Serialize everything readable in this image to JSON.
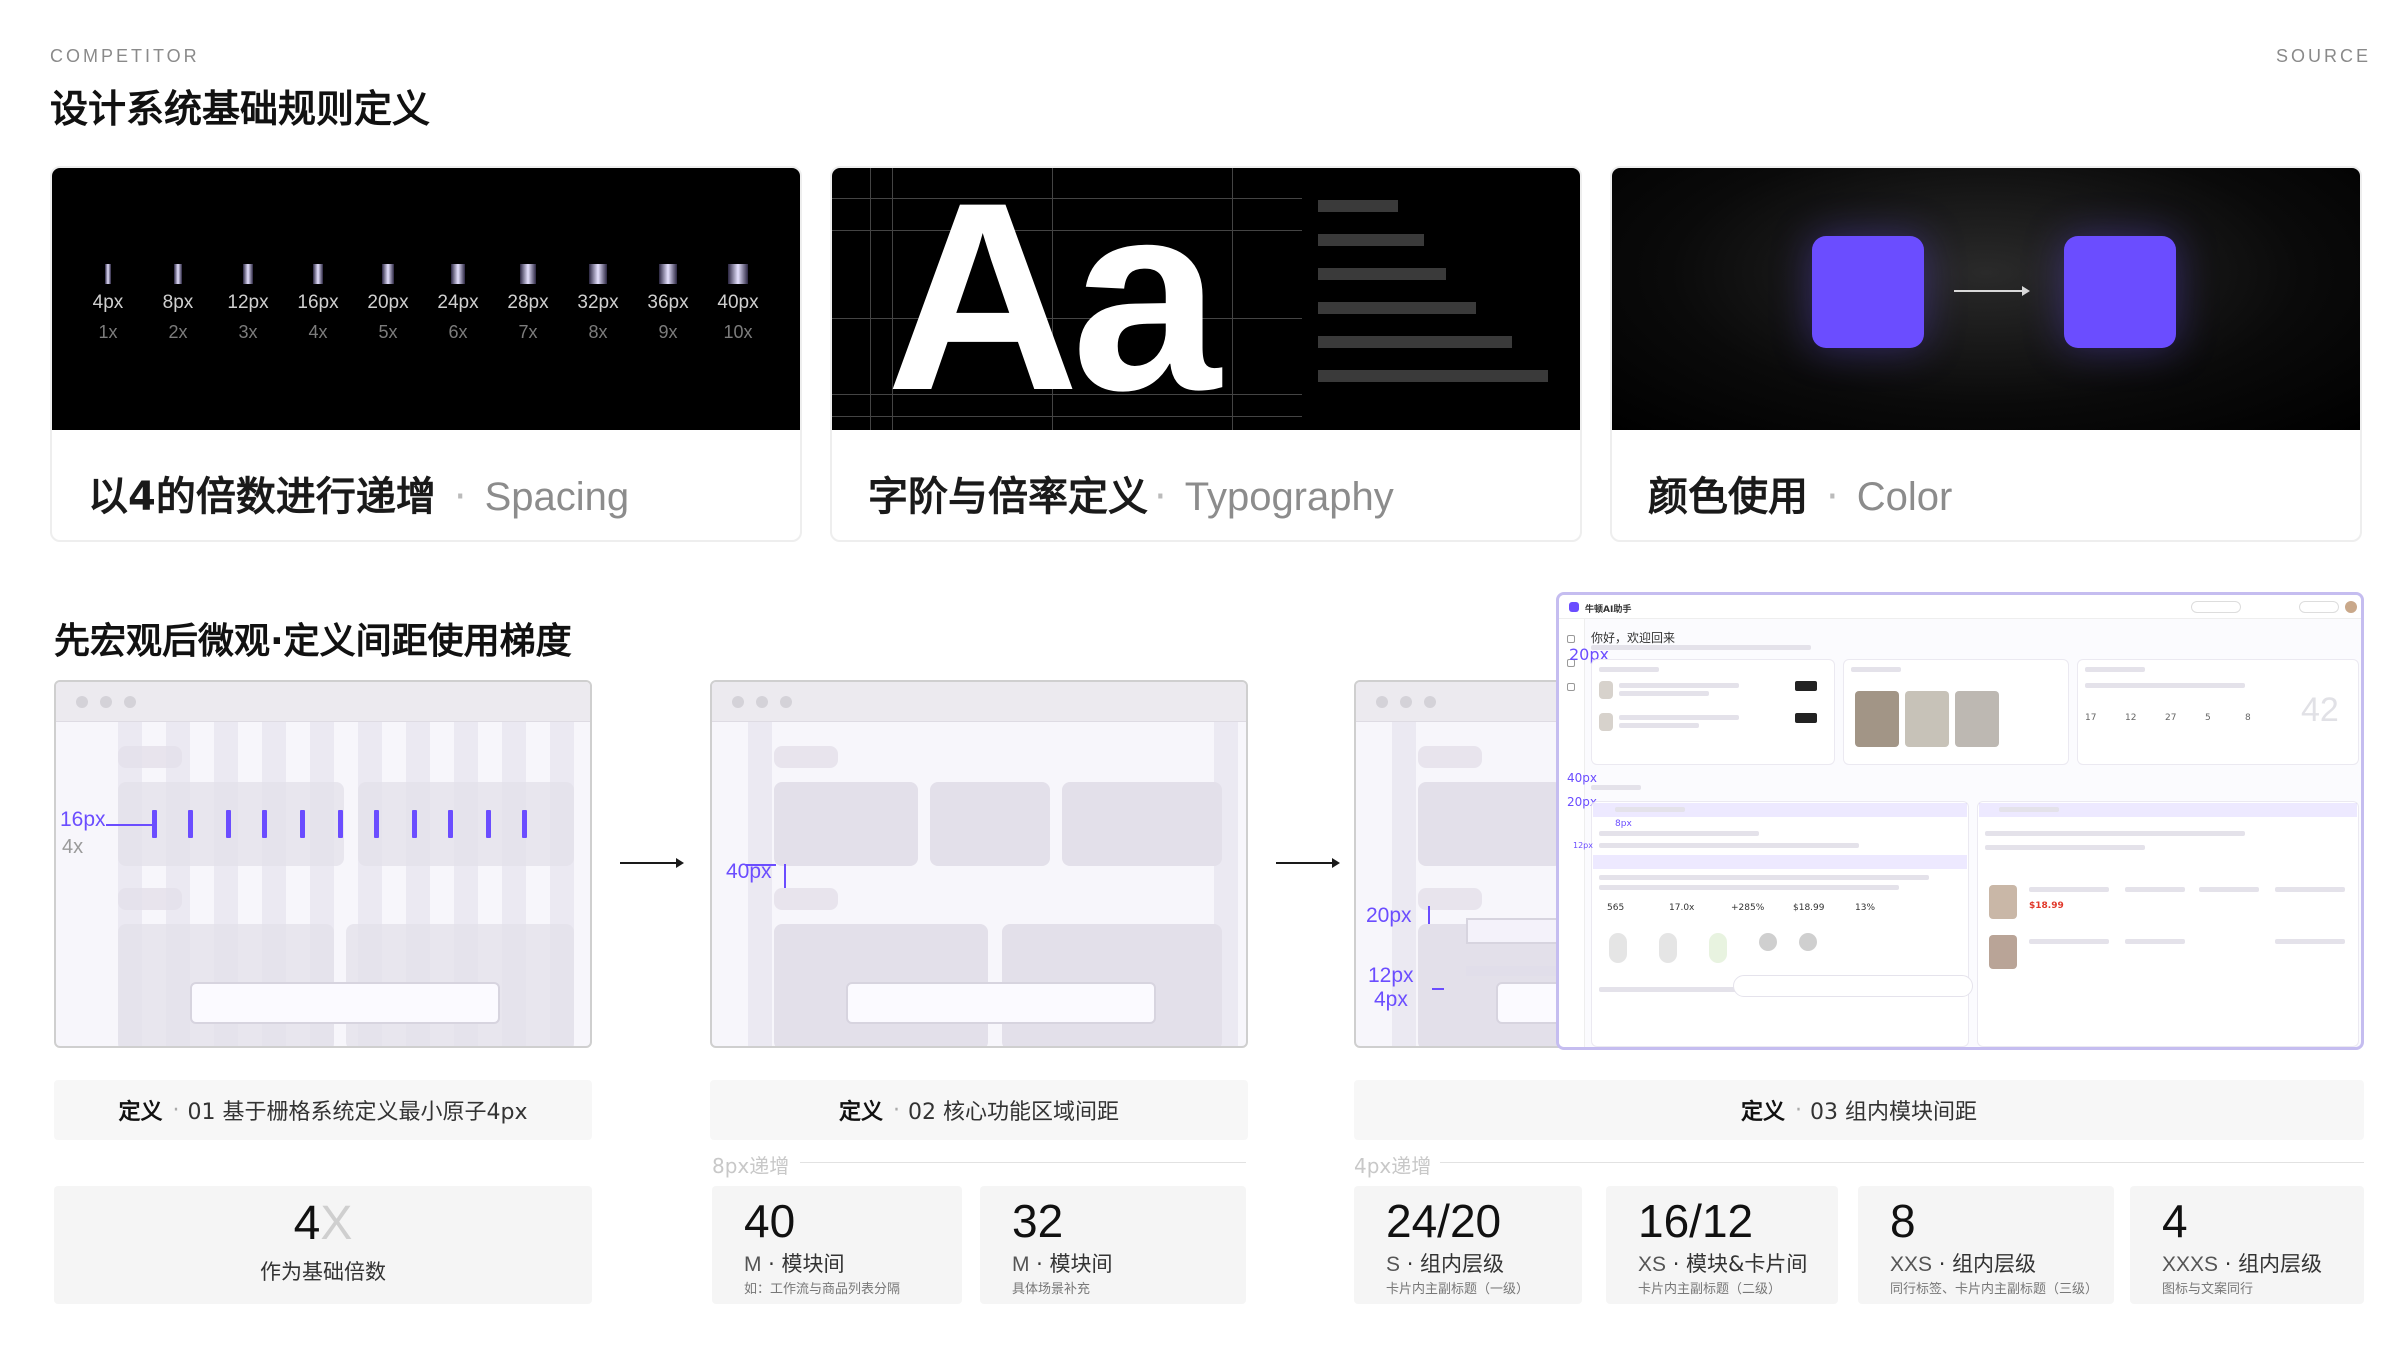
{
  "header": {
    "eyebrow": "COMPETITOR",
    "title": "设计系统基础规则定义",
    "source": "SOURCE"
  },
  "cards": {
    "spacing": {
      "title": "以4的倍数进行递增",
      "en": "Spacing",
      "items": [
        {
          "px": "4px",
          "mul": "1x"
        },
        {
          "px": "8px",
          "mul": "2x"
        },
        {
          "px": "12px",
          "mul": "3x"
        },
        {
          "px": "16px",
          "mul": "4x"
        },
        {
          "px": "20px",
          "mul": "5x"
        },
        {
          "px": "24px",
          "mul": "6x"
        },
        {
          "px": "28px",
          "mul": "7x"
        },
        {
          "px": "32px",
          "mul": "8x"
        },
        {
          "px": "36px",
          "mul": "9x"
        },
        {
          "px": "40px",
          "mul": "10x"
        }
      ]
    },
    "typography": {
      "title": "字阶与倍率定义",
      "en": "Typography",
      "sample": "Aa"
    },
    "color": {
      "title": "颜色使用",
      "en": "Color",
      "accent": "#6b4dff"
    }
  },
  "section2": {
    "title": "先宏观后微观·定义间距使用梯度",
    "frame1": {
      "px": "16px",
      "mul": "4x"
    },
    "frame2": {
      "px": "40px"
    },
    "frame3": {
      "px20": "20px",
      "px12": "12px",
      "px4": "4px"
    },
    "shot": {
      "app_name": "牛顿AI助手",
      "greeting": "你好，欢迎回来",
      "a20": "20px",
      "a40": "40px",
      "a20b": "20px",
      "a8": "8px",
      "a12": "12px",
      "stats": [
        "565",
        "17.0x",
        "+285%",
        "$18.99",
        "13%"
      ],
      "stats2": [
        "17",
        "12",
        "27",
        "5",
        "8"
      ],
      "big_num": "42",
      "price": "$18.99"
    },
    "defs": [
      {
        "label": "定义",
        "text": "01 基于栅格系统定义最小原子4px"
      },
      {
        "label": "定义",
        "text": "02 核心功能区域间距"
      },
      {
        "label": "定义",
        "text": "03 组内模块间距"
      }
    ],
    "steps": {
      "s8": "8px递增",
      "s4": "4px递增"
    },
    "base": {
      "num": "4",
      "x": "X",
      "label": "作为基础倍数"
    },
    "stats": [
      {
        "num": "40",
        "code": "M",
        "name": "模块间",
        "note": "如：工作流与商品列表分隔"
      },
      {
        "num": "32",
        "code": "M",
        "name": "模块间",
        "note": "具体场景补充"
      },
      {
        "num": "24/20",
        "code": "S",
        "name": "组内层级",
        "note": "卡片内主副标题（一级）"
      },
      {
        "num": "16/12",
        "code": "XS",
        "name": "模块&卡片间",
        "note": "卡片内主副标题（二级）"
      },
      {
        "num": "8",
        "code": "XXS",
        "name": "组内层级",
        "note": "同行标签、卡片内主副标题（三级）"
      },
      {
        "num": "4",
        "code": "XXXS",
        "name": "组内层级",
        "note": "图标与文案同行"
      }
    ]
  }
}
